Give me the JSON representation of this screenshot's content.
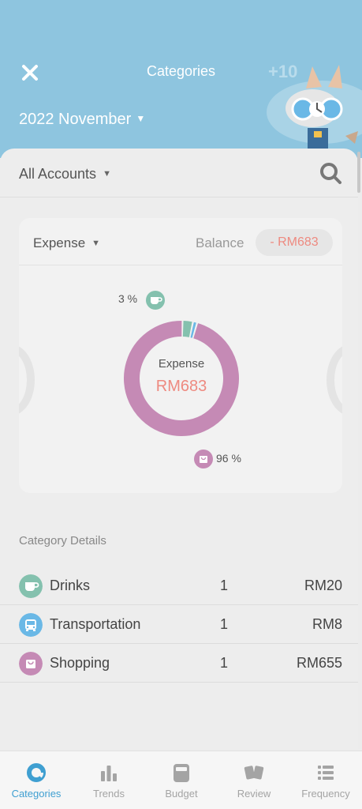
{
  "header": {
    "title": "Categories",
    "month": "2022 November",
    "bonus": "+10",
    "color": "#8ec5df"
  },
  "filter": {
    "accounts_label": "All Accounts"
  },
  "summary": {
    "type_label": "Expense",
    "balance_label": "Balance",
    "balance_value": "- RM683",
    "donut_label": "Expense",
    "donut_value": "RM683",
    "drinks_pct": "3 %",
    "shopping_pct": "96 %"
  },
  "chart_data": {
    "type": "pie",
    "categories": [
      "Shopping",
      "Drinks",
      "Transportation"
    ],
    "values": [
      655,
      20,
      8
    ],
    "colors": [
      "#c58ab5",
      "#84c1ae",
      "#6ab8e6"
    ],
    "title": ""
  },
  "details": {
    "title": "Category Details",
    "rows": [
      {
        "name": "Drinks",
        "count": "1",
        "amount": "RM20",
        "color": "#84c1ae",
        "icon": "cup-icon"
      },
      {
        "name": "Transportation",
        "count": "1",
        "amount": "RM8",
        "color": "#6ab8e6",
        "icon": "bus-icon"
      },
      {
        "name": "Shopping",
        "count": "1",
        "amount": "RM655",
        "color": "#c58ab5",
        "icon": "bag-icon"
      }
    ]
  },
  "nav": {
    "items": [
      {
        "label": "Categories",
        "icon": "pie-icon",
        "active": true
      },
      {
        "label": "Trends",
        "icon": "bar-chart-icon",
        "active": false
      },
      {
        "label": "Budget",
        "icon": "wallet-icon",
        "active": false
      },
      {
        "label": "Review",
        "icon": "cards-icon",
        "active": false
      },
      {
        "label": "Frequency",
        "icon": "list-icon",
        "active": false
      }
    ],
    "active_color": "#3f9fd1"
  }
}
